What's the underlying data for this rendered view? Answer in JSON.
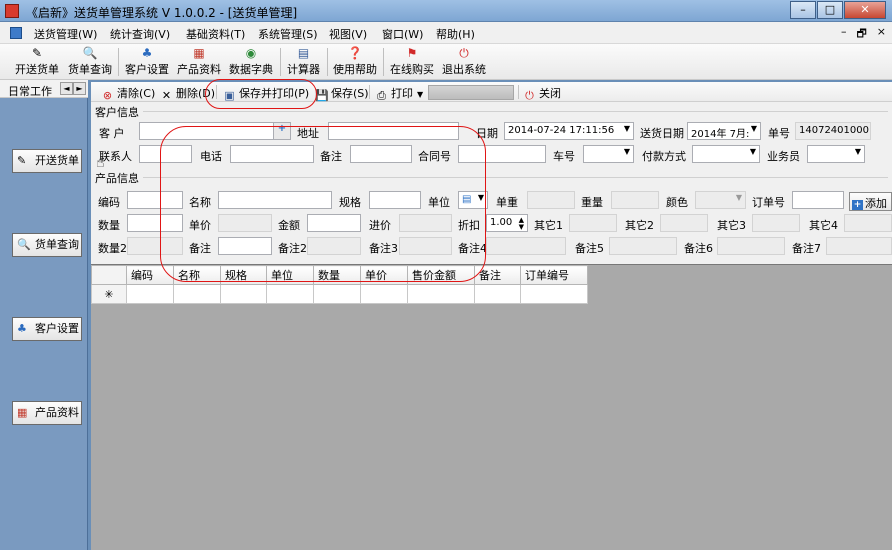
{
  "window": {
    "title": "《启新》送货单管理系统 V 1.0.0.2 - [送货单管理]",
    "controls": [
      "–",
      "□",
      "✕"
    ]
  },
  "menubar": {
    "items": [
      "送货管理(W)",
      "统计查询(V)",
      "基础资料(T)",
      "系统管理(S)",
      "视图(V)",
      "窗口(W)",
      "帮助(H)"
    ],
    "mdi_controls": [
      "–",
      "🗗",
      "×"
    ]
  },
  "toolbar": {
    "items": [
      {
        "label": "开送货单",
        "icon": "edit-icon"
      },
      {
        "label": "货单查询",
        "icon": "search-icon"
      },
      {
        "label": "客户设置",
        "icon": "customer-icon"
      },
      {
        "label": "产品资料",
        "icon": "product-icon"
      },
      {
        "label": "数据字典",
        "icon": "dictionary-icon"
      },
      {
        "label": "计算器",
        "icon": "calculator-icon"
      },
      {
        "label": "使用帮助",
        "icon": "help-icon"
      },
      {
        "label": "在线购买",
        "icon": "flag-icon"
      },
      {
        "label": "退出系统",
        "icon": "exit-icon"
      }
    ]
  },
  "leftnav": {
    "header": "日常工作",
    "arrows": [
      "◄",
      "►"
    ],
    "buttons": [
      "开送货单",
      "货单查询",
      "客户设置",
      "产品资料"
    ]
  },
  "subtoolbar": {
    "clear": "清除(C)",
    "delete": "删除(D)",
    "save_print": "保存并打印(P)",
    "save": "保存(S)",
    "print": "打印",
    "close": "关闭"
  },
  "customer": {
    "section": "客户信息",
    "customer_label": "客  户",
    "address_label": "地址",
    "date_label": "日期",
    "date_value": "2014-07-24 17:11:56",
    "delivery_date_label": "送货日期",
    "delivery_date_value": "2014年 7月:",
    "order_no_label": "单号",
    "order_no_value": "140724010001",
    "contact_label": "联系人",
    "phone_label": "电话",
    "note_label": "备注",
    "contract_label": "合同号",
    "car_label": "车号",
    "payment_label": "付款方式",
    "salesman_label": "业务员"
  },
  "product": {
    "section": "产品信息",
    "code_label": "编码",
    "name_label": "名称",
    "spec_label": "规格",
    "unit_label": "单位",
    "unit_weight_label": "单重",
    "weight_label": "重量",
    "color_label": "颜色",
    "order_no_label": "订单号",
    "add_label": "添加",
    "qty_label": "数量",
    "price_label": "单价",
    "amount_label": "金额",
    "cost_label": "进价",
    "discount_label": "折扣",
    "discount_value": "1.00",
    "other1_label": "其它1",
    "other2_label": "其它2",
    "other3_label": "其它3",
    "other4_label": "其它4",
    "qty2_label": "数量2",
    "note_label": "备注",
    "note2_label": "备注2",
    "note3_label": "备注3",
    "note4_label": "备注4",
    "note5_label": "备注5",
    "note6_label": "备注6",
    "note7_label": "备注7"
  },
  "grid": {
    "columns": [
      "编码",
      "名称",
      "规格",
      "单位",
      "数量",
      "单价",
      "售价金额",
      "备注",
      "订单编号"
    ],
    "new_row_marker": "✳"
  },
  "colors": {
    "annotation": "#e01515",
    "workspace": "#a9a9a9",
    "nav_bg": "#7a9ac0"
  }
}
